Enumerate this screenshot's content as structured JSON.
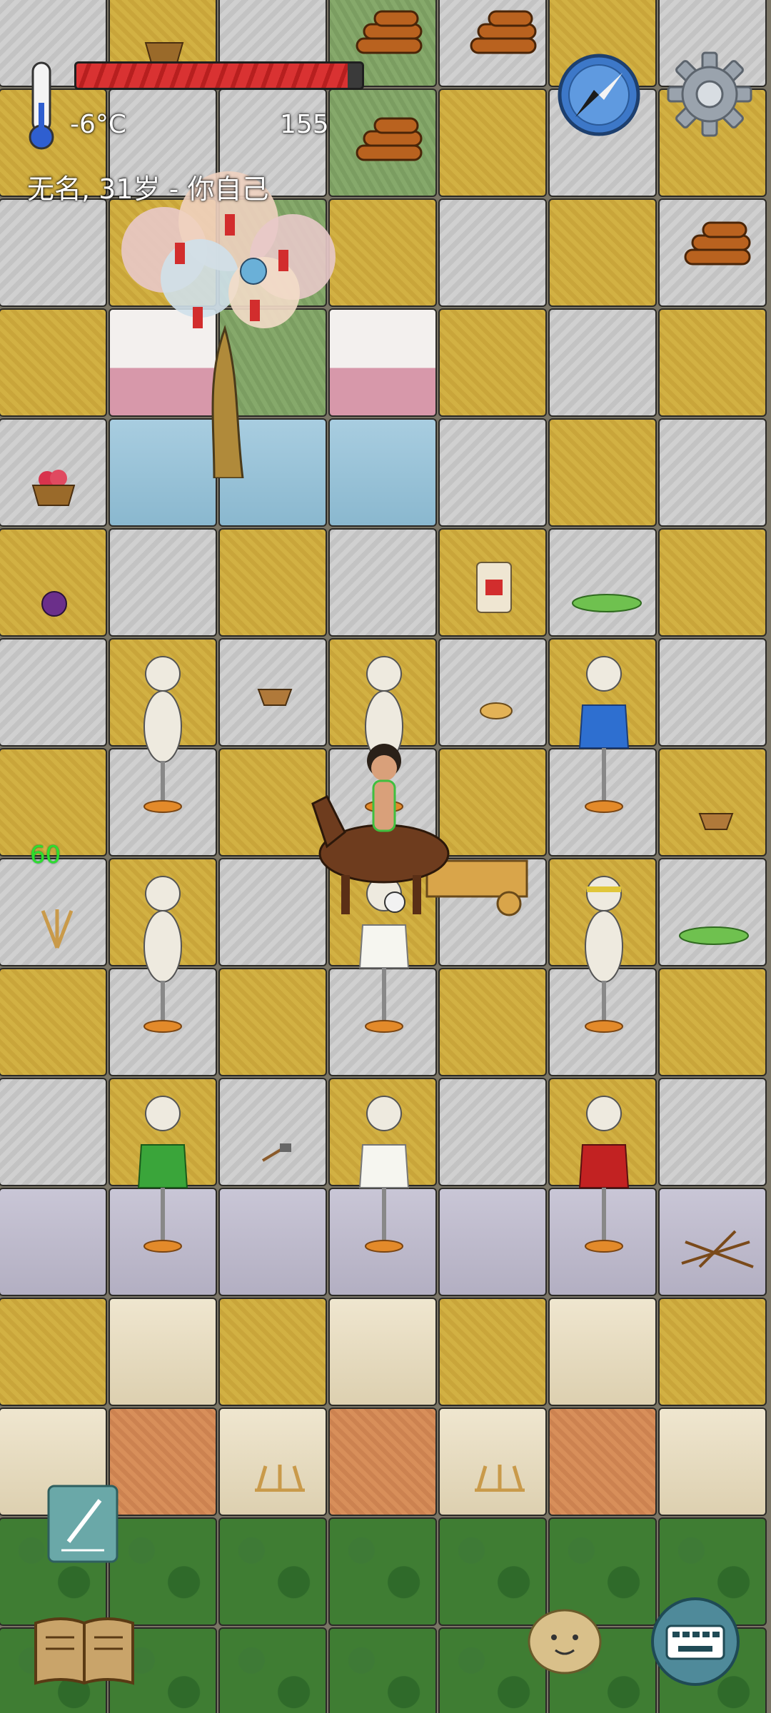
{
  "hud": {
    "temperature": "-6°C",
    "food_value": "155",
    "player_label": "无名, 31岁 - 你自己",
    "health_fraction": 0.95,
    "counter": "60"
  },
  "icons": {
    "thermometer": "thermometer-icon",
    "compass": "compass-icon",
    "settings": "gear-icon",
    "pencil": "pencil-icon",
    "book": "book-icon",
    "emote": "potato-face-icon",
    "keyboard": "keyboard-icon"
  },
  "colors": {
    "health_red": "#d93232",
    "counter_green": "#2ce02c",
    "floor_yellow": "#d2b143",
    "floor_gray": "#d0d0d0"
  }
}
